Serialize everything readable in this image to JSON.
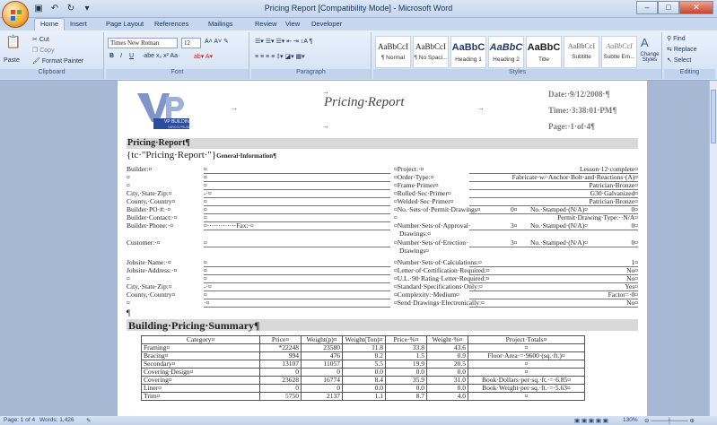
{
  "window": {
    "title": "Pricing Report [Compatibility Mode] - Microsoft Word",
    "controls": [
      "–",
      "□",
      "✕"
    ]
  },
  "tabs": [
    "Home",
    "Insert",
    "Page Layout",
    "References",
    "Mailings",
    "Review",
    "View",
    "Developer"
  ],
  "ribbon": {
    "clipboard": {
      "label": "Clipboard",
      "paste": "Paste",
      "cut": "Cut",
      "copy": "Copy",
      "format_painter": "Format Painter"
    },
    "font": {
      "label": "Font",
      "name": "Times New Roman",
      "size": "12"
    },
    "paragraph": {
      "label": "Paragraph"
    },
    "styles": {
      "label": "Styles",
      "items": [
        {
          "sample": "AaBbCcI",
          "name": "¶ Normal"
        },
        {
          "sample": "AaBbCcI",
          "name": "¶ No Spaci..."
        },
        {
          "sample": "AaBbC",
          "name": "Heading 1"
        },
        {
          "sample": "AaBbC",
          "name": "Heading 2"
        },
        {
          "sample": "AaBbC",
          "name": "Title"
        },
        {
          "sample": "AaBbCcI",
          "name": "Subtitle"
        },
        {
          "sample": "AaBbCcI",
          "name": "Subtle Em..."
        }
      ],
      "change_styles": "Change Styles"
    },
    "editing": {
      "label": "Editing",
      "find": "Find",
      "replace": "Replace",
      "select": "Select"
    }
  },
  "doc": {
    "header": {
      "logo_text": "VP BUILDINGS",
      "logo_sub": "VARCO-PRUDEN",
      "title": "Pricing·Report",
      "date": "Date:·9/12/2008·¶",
      "time": "Time:·3:38:01·PM¶",
      "page": "Page:·1·of·4¶"
    },
    "section1_title": "Pricing·Report¶",
    "tc_field": "{tc·\"Pricing·Report·\"}",
    "general_info": "General·Information¶",
    "left_rows": [
      "Builder:¤",
      "¤",
      "¤",
      "City,·State·Zip:¤",
      "County,·Country¤",
      "Builder·PO·#:·¤",
      "Builder·Contact:·¤",
      "Builder·Phone:·¤",
      "",
      "Customer:·¤",
      "",
      "Jobsite·Name:·¤",
      "Jobsite·Address:·¤",
      "¤",
      "City,·State·Zip:¤",
      "County,·Country¤",
      "¤"
    ],
    "left_values": [
      "¤",
      "¤",
      "¤",
      "-·¤",
      "¤",
      "¤",
      "¤",
      "¤·············Fax:·¤",
      "",
      "¤",
      "",
      "¤",
      "¤",
      "¤",
      "-·¤",
      "¤",
      "·¤"
    ],
    "right_rows": [
      {
        "label": "¤Project:·¤",
        "value": "Lesson·12·complete¤"
      },
      {
        "label": "¤Order·Type:¤",
        "value": "Fabricate·w/·Anchor·Bolt·and·Reactions·(A)¤"
      },
      {
        "label": "¤Frame·Primer¤",
        "value": "Patrician·Bronze¤"
      },
      {
        "label": "¤Rolled·Sec·Primer¤",
        "value": "G30·Galvanized¤"
      },
      {
        "label": "¤Welded·Sec·Primer¤",
        "value": "Patrician·Bronze¤"
      },
      {
        "label": "¤No.·Sets·of·Permit·Drawings¤",
        "value": "0¤"
      },
      {
        "label": "¤",
        "value": "Permit·Drawing·Type:··N/A¤"
      },
      {
        "label": "¤Number·Sets·of·Approval·",
        "value": "0¤"
      },
      {
        "label": "Drawings:¤",
        "value": ""
      },
      {
        "label": "¤Number·Sets·of·Erection·",
        "value": "0¤"
      },
      {
        "label": "Drawings¤",
        "value": ""
      },
      {
        "label": "¤Number·Sets·of·Calculations:¤",
        "value": "1¤"
      },
      {
        "label": "¤Letter·of·Certification·Required:¤",
        "value": "No¤"
      },
      {
        "label": "¤U.L.·90·Rating·Letter·Required:¤",
        "value": "No¤"
      },
      {
        "label": "¤Standard·Specifications·Only:¤",
        "value": "Yes¤"
      },
      {
        "label": "¤Complexity:·Medium¤",
        "value": "Factor=·0¤"
      },
      {
        "label": "¤Send·Drawings·Electronically:¤",
        "value": "No¤"
      }
    ],
    "stamped_rows": [
      {
        "num": "0¤",
        "text": "No.·Stamped·(N/A)¤"
      },
      {
        "num": "3¤",
        "text": "No.·Stamped·(N/A)¤"
      },
      {
        "num": "3¤",
        "text": "No.·Stamped·(N/A)¤"
      }
    ],
    "pilcrow": "¶",
    "section2_title": "Building·Pricing·Summary¶",
    "table": {
      "headers": [
        "Category¤",
        "Price¤",
        "Weight(p)¤",
        "Weight(Ton)¤",
        "Price·%¤",
        "Weight·%¤",
        "Project·Totals¤"
      ],
      "rows": [
        [
          "Framing¤",
          "*22248",
          "23580",
          "11.8",
          "33.8",
          "43.6",
          "¤"
        ],
        [
          "Bracing¤",
          "994",
          "476",
          "0.2",
          "1.5",
          "0.9",
          "Floor·Area·=·9600·(sq.·ft.)¤"
        ],
        [
          "Secondary¤",
          "13107",
          "11057",
          "5.5",
          "19.9",
          "20.5",
          "¤"
        ],
        [
          "Covering·Design¤",
          "0",
          "0",
          "0.0",
          "0.0",
          "0.0",
          "¤"
        ],
        [
          "Covering¤",
          "23628",
          "16774",
          "8.4",
          "35.9",
          "31.0",
          "Book·Dollars·per·sq.·ft.·=·6.85¤"
        ],
        [
          "Liner¤",
          "0",
          "0",
          "0.0",
          "0.0",
          "0.0",
          "Book·Weight·per·sq.·ft.·=·5.63¤"
        ],
        [
          "Trim¤",
          "5750",
          "2137",
          "1.1",
          "8.7",
          "4.0",
          "¤"
        ]
      ]
    }
  },
  "status": {
    "page": "Page: 1 of 4",
    "words": "Words: 1,426",
    "zoom": "130%"
  }
}
